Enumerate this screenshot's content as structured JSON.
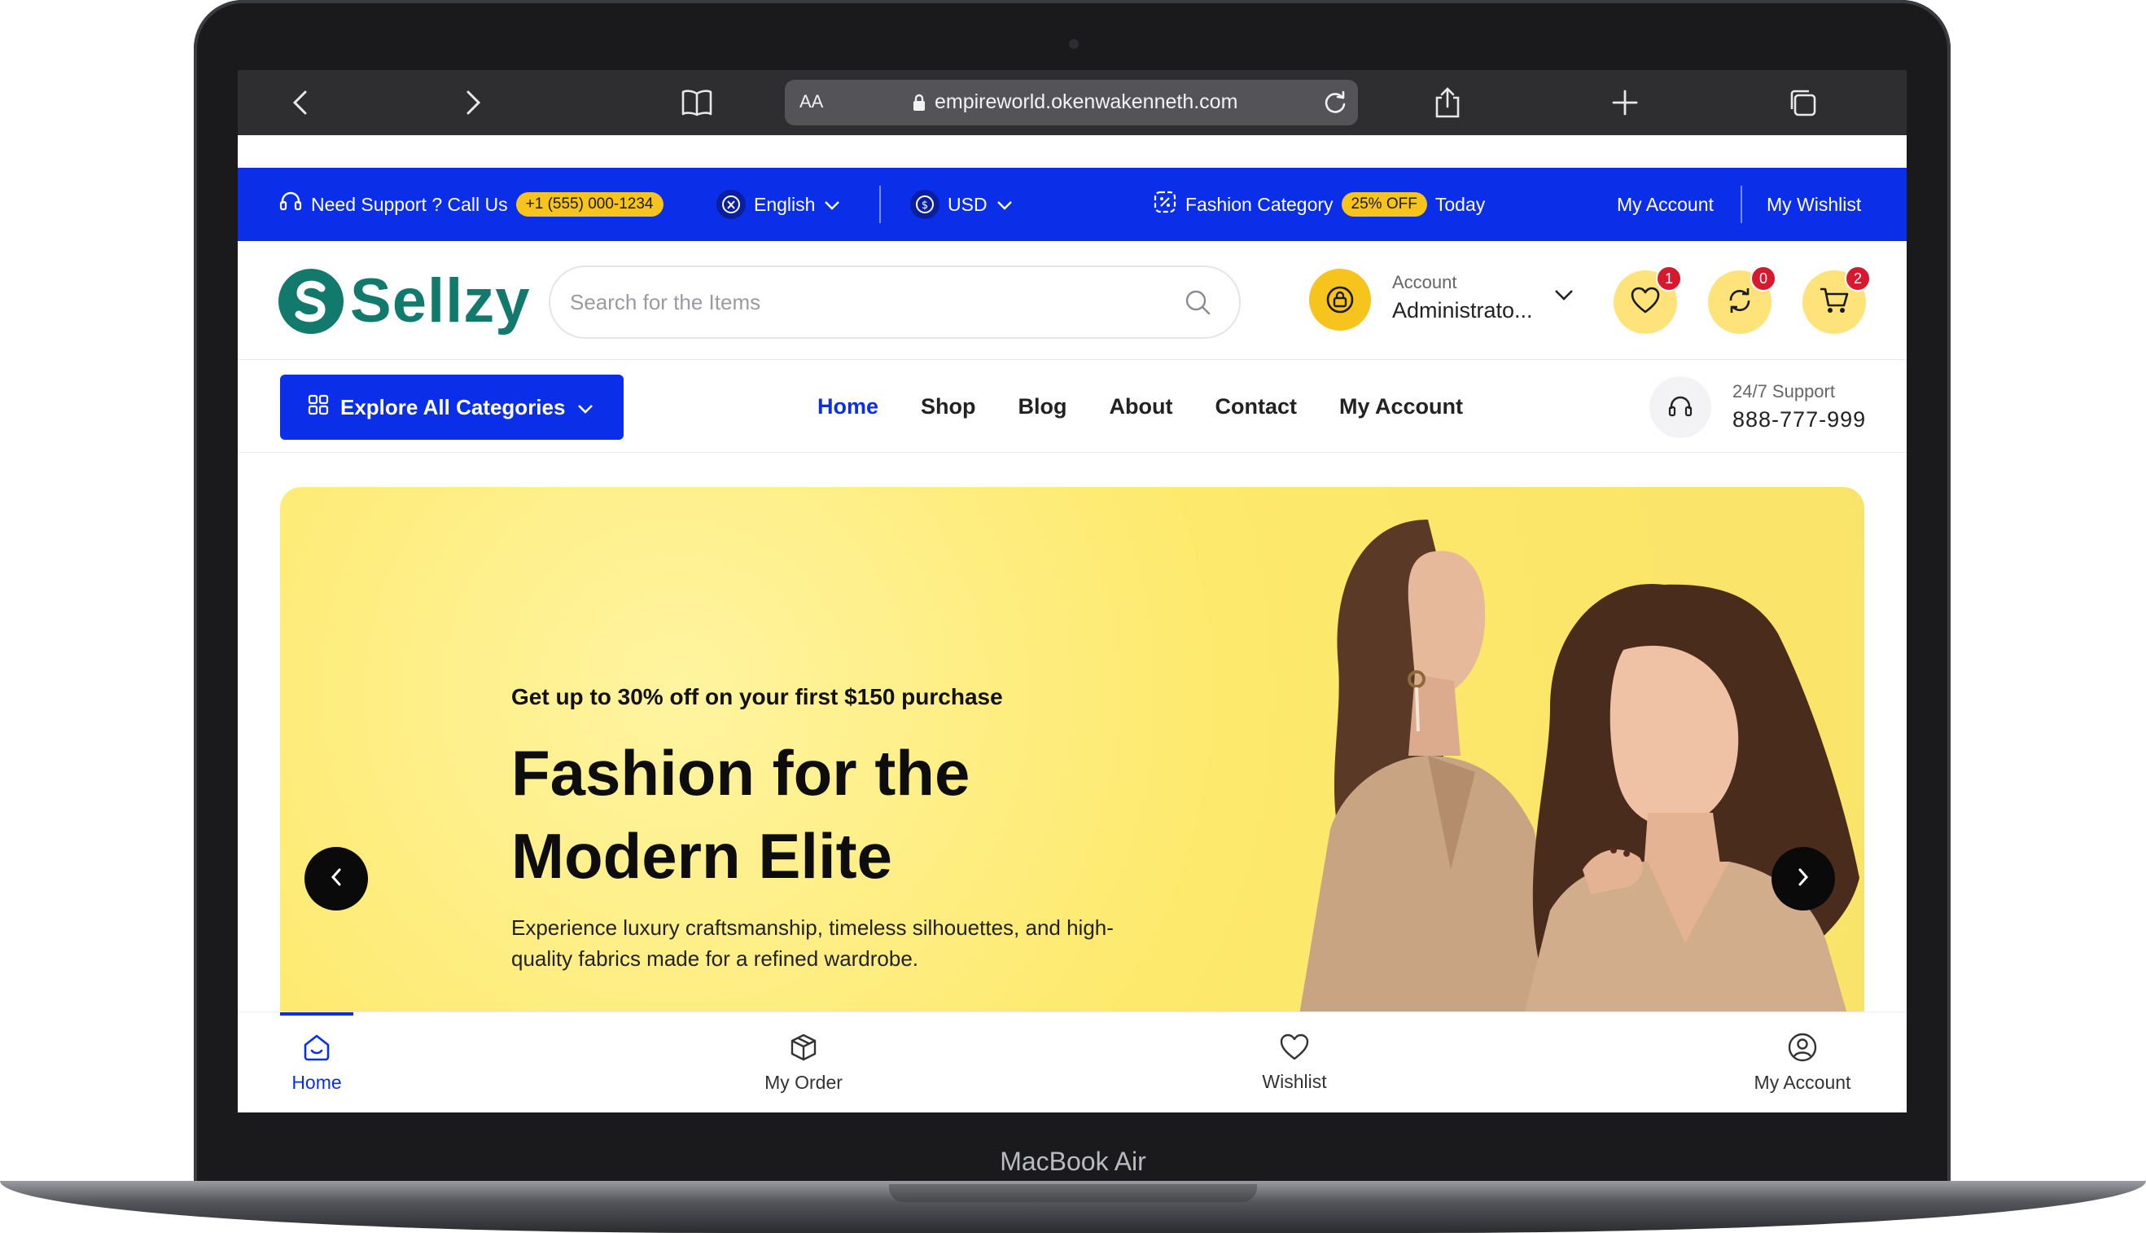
{
  "device": {
    "label": "MacBook Air"
  },
  "browser": {
    "text_size_label": "AA",
    "url": "empireworld.okenwakenneth.com"
  },
  "topbar": {
    "support_text": "Need Support ?  Call Us",
    "support_phone": "+1 (555) 000-1234",
    "language": "English",
    "currency": "USD",
    "promo_text": "Fashion Category",
    "promo_badge": "25% OFF",
    "promo_suffix": "Today",
    "my_account": "My Account",
    "my_wishlist": "My Wishlist"
  },
  "header": {
    "logo_text": "Sellzy",
    "search_placeholder": "Search for the Items",
    "account_label": "Account",
    "account_name": "Administrato...",
    "wishlist_count": "1",
    "compare_count": "0",
    "cart_count": "2"
  },
  "nav": {
    "explore_label": "Explore All Categories",
    "links": [
      "Home",
      "Shop",
      "Blog",
      "About",
      "Contact",
      "My Account"
    ],
    "support_label": "24/7 Support",
    "support_phone": "888-777-999"
  },
  "hero": {
    "subtitle": "Get up to 30% off on your first $150 purchase",
    "title": "Fashion for the Modern Elite",
    "description": "Experience luxury craftsmanship, timeless silhouettes, and high-quality fabrics made for a refined wardrobe."
  },
  "tabbar": {
    "items": [
      "Home",
      "My Order",
      "Wishlist",
      "My Account"
    ]
  },
  "colors": {
    "brand_blue": "#0b2ee8",
    "accent_yellow": "#f7c31d",
    "logo_green": "#127a6c",
    "hero_yellow": "#fde96b",
    "badge_red": "#d7192f"
  }
}
